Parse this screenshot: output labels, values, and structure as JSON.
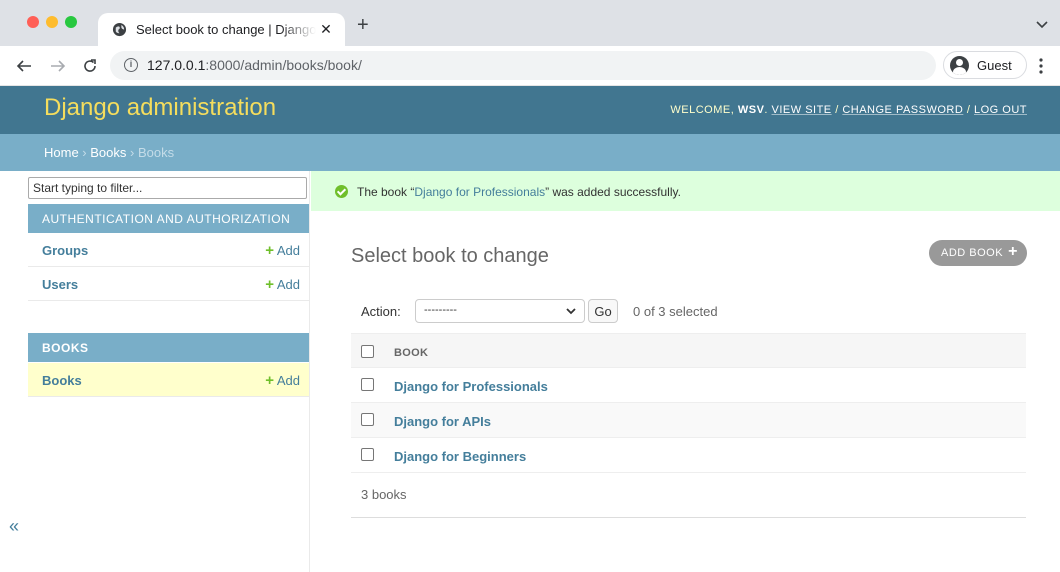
{
  "browser": {
    "tab_title": "Select book to change | Django site admin",
    "url_host": "127.0.0.1",
    "url_rest": ":8000/admin/books/book/",
    "profile_label": "Guest",
    "new_tab_symbol": "+",
    "close_symbol": "✕"
  },
  "header": {
    "brand": "Django administration",
    "welcome": "Welcome, ",
    "username": "WSV",
    "view_site": "View site",
    "change_password": "Change password",
    "log_out": "Log out",
    "separator": " / "
  },
  "breadcrumbs": {
    "home": "Home",
    "app": "Books",
    "current": "Books",
    "sep": " › "
  },
  "sidebar": {
    "filter_placeholder": "Start typing to filter...",
    "modules": [
      {
        "caption": "Authentication and Authorization",
        "models": [
          {
            "name": "Groups",
            "add": "Add"
          },
          {
            "name": "Users",
            "add": "Add"
          }
        ]
      },
      {
        "caption": "Books",
        "models": [
          {
            "name": "Books",
            "add": "Add"
          }
        ]
      }
    ],
    "collapse_symbol": "«"
  },
  "message": {
    "prefix": "The book “",
    "link": "Django for Professionals",
    "suffix": "” was added successfully."
  },
  "main": {
    "title": "Select book to change",
    "add_button": "Add book",
    "action_label": "Action:",
    "action_value": "---------",
    "go_label": "Go",
    "selected_count": "0 of 3 selected",
    "column_header": "Book",
    "rows": [
      "Django for Professionals",
      "Django for APIs",
      "Django for Beginners"
    ],
    "paginator": "3 books"
  },
  "colors": {
    "header_bg": "#417690",
    "brand": "#f5dd5d",
    "breadcrumbs_bg": "#79aec8",
    "link": "#447e9b",
    "success_bg": "#ddffdd",
    "current_model_bg": "#ffffcc"
  },
  "icons": [
    "globe-icon",
    "info-icon",
    "back-arrow-icon",
    "forward-arrow-icon",
    "reload-icon",
    "user-avatar-icon",
    "kebab-menu-icon",
    "success-check-icon",
    "plus-icon",
    "chevron-down-icon"
  ]
}
